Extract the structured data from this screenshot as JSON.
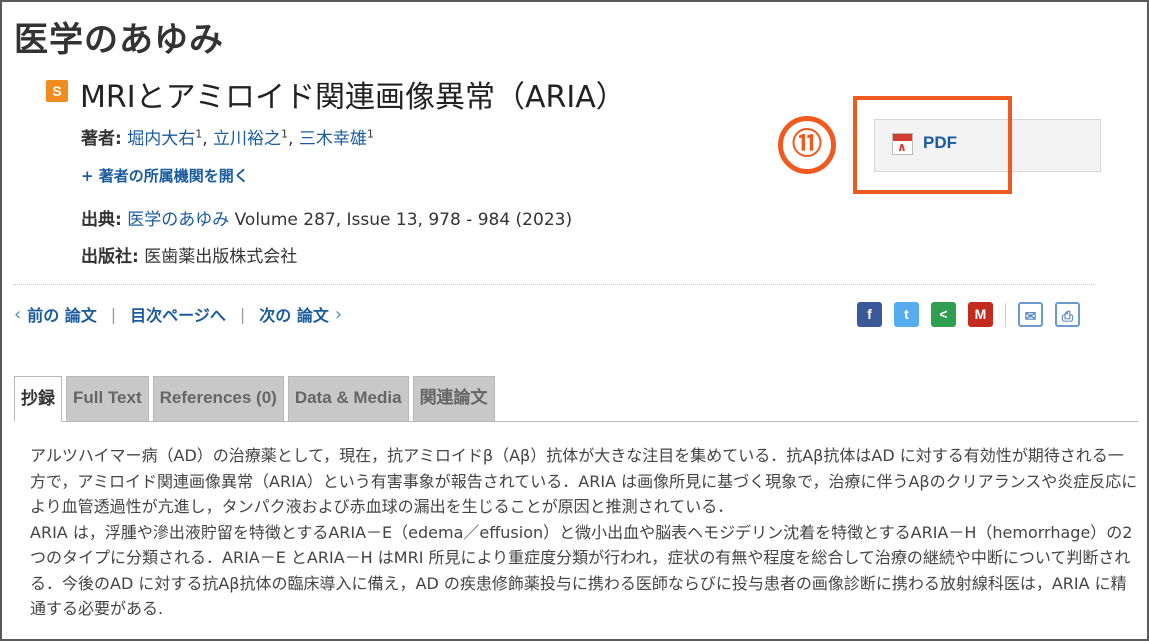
{
  "journal": {
    "title": "医学のあゆみ"
  },
  "article": {
    "badge": "S",
    "title": "MRIとアミロイド関連画像異常（ARIA）"
  },
  "authors": {
    "label": "著者:",
    "list": [
      {
        "name": "堀内大右",
        "sup": "1"
      },
      {
        "name": "立川裕之",
        "sup": "1"
      },
      {
        "name": "三木幸雄",
        "sup": "1"
      }
    ],
    "separator": ","
  },
  "affiliation_toggle": "+ 著者の所属機関を開く",
  "source": {
    "label": "出典:",
    "journal_link": "医学のあゆみ",
    "citation": " Volume 287, Issue 13, 978 - 984 (2023)"
  },
  "publisher": {
    "label": "出版社:",
    "name": "医歯薬出版株式会社"
  },
  "pdf": {
    "label": "PDF",
    "annotation_number": "⑪",
    "annotation_color": "#f05a1e"
  },
  "nav": {
    "prev": "前の 論文",
    "toc": "目次ページへ",
    "next": "次の 論文",
    "separator": "|",
    "chevron_left": "‹",
    "chevron_right": "›"
  },
  "share": [
    {
      "id": "facebook",
      "icon": "facebook-icon",
      "glyph": "f",
      "color": "#3b5998"
    },
    {
      "id": "twitter",
      "icon": "twitter-icon",
      "glyph": "t",
      "color": "#55acee"
    },
    {
      "id": "share",
      "icon": "share-icon",
      "glyph": "<",
      "color": "#2e9e4f"
    },
    {
      "id": "mendeley",
      "icon": "mendeley-icon",
      "glyph": "M",
      "color": "#c42b1e"
    },
    {
      "id": "mail",
      "icon": "mail-icon",
      "glyph": "✉"
    },
    {
      "id": "print",
      "icon": "print-icon",
      "glyph": "⎙"
    }
  ],
  "tabs": [
    {
      "id": "abstract",
      "label": "抄録",
      "active": true
    },
    {
      "id": "fulltext",
      "label": "Full Text",
      "active": false
    },
    {
      "id": "references",
      "label": "References (0)",
      "active": false
    },
    {
      "id": "data-media",
      "label": "Data & Media",
      "active": false
    },
    {
      "id": "related",
      "label": "関連論文",
      "active": false
    }
  ],
  "abstract": {
    "text": [
      "アルツハイマー病（AD）の治療薬として，現在，抗アミロイドβ（Aβ）抗体が大きな注目を集めている．抗Aβ抗体はAD に対する有効性が期待される一方で，アミロイド関連画像異常（ARIA）という有害事象が報告されている．ARIA は画像所見に基づく現象で，治療に伴うAβのクリアランスや炎症反応により血管透過性が亢進し，タンパク液および赤血球の漏出を生じることが原因と推測されている．",
      "ARIA は，浮腫や滲出液貯留を特徴とするARIA－E（edema／effusion）と微小出血や脳表ヘモジデリン沈着を特徴とするARIA－H（hemorrhage）の2 つのタイプに分類される．ARIA－E とARIA－H はMRI 所見により重症度分類が行われ，症状の有無や程度を総合して治療の継続や中断について判断される．今後のAD に対する抗Aβ抗体の臨床導入に備え，AD の疾患修飾薬投与に携わる医師ならびに投与患者の画像診断に携わる放射線科医は，ARIA に精通する必要がある."
    ]
  }
}
